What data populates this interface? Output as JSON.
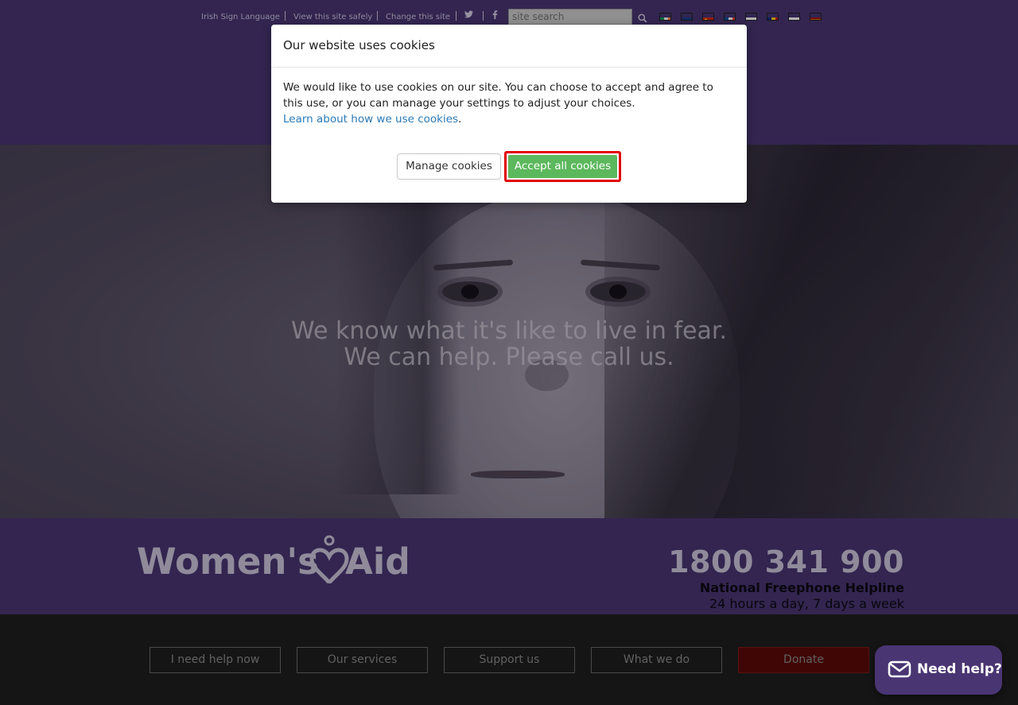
{
  "utility_bar": {
    "irish_sign_language": "Irish Sign Language",
    "view_safely": "View this site safely",
    "change_site": "Change this site",
    "twitter_icon": "twitter-icon",
    "facebook_icon": "facebook-icon",
    "search_placeholder": "site search",
    "search_icon": "search-icon",
    "flags": [
      "ireland-flag",
      "accessibility-flag",
      "china-flag",
      "france-flag",
      "poland-flag",
      "romania-flag",
      "russia-flag",
      "spain-flag"
    ]
  },
  "hero": {
    "line1": "We know what it's like to live in fear.",
    "line2": "We can help. Please call us."
  },
  "info": {
    "logo_text": "Women's Aid",
    "phone": "1800 341 900",
    "helpline": "National Freephone Helpline",
    "hours": "24 hours a day, 7 days a week"
  },
  "nav": {
    "items": [
      "I need help now",
      "Our services",
      "Support us",
      "What we do",
      "Donate"
    ]
  },
  "cookie_modal": {
    "title": "Our website uses cookies",
    "body": "We would like to use cookies on our site. You can choose to accept and agree to this use, or you can manage your settings to adjust your choices.",
    "learn_link": "Learn about how we use cookies",
    "manage_button": "Manage cookies",
    "accept_button": "Accept all cookies"
  },
  "chat_widget": {
    "label": "Need help?",
    "icon": "mail-icon"
  },
  "colors": {
    "brand_purple": "#4a3573",
    "accept_green": "#5cb85c",
    "highlight_red": "#e00000",
    "donate_red": "#5c0a0a",
    "link_blue": "#2a7ab8"
  }
}
